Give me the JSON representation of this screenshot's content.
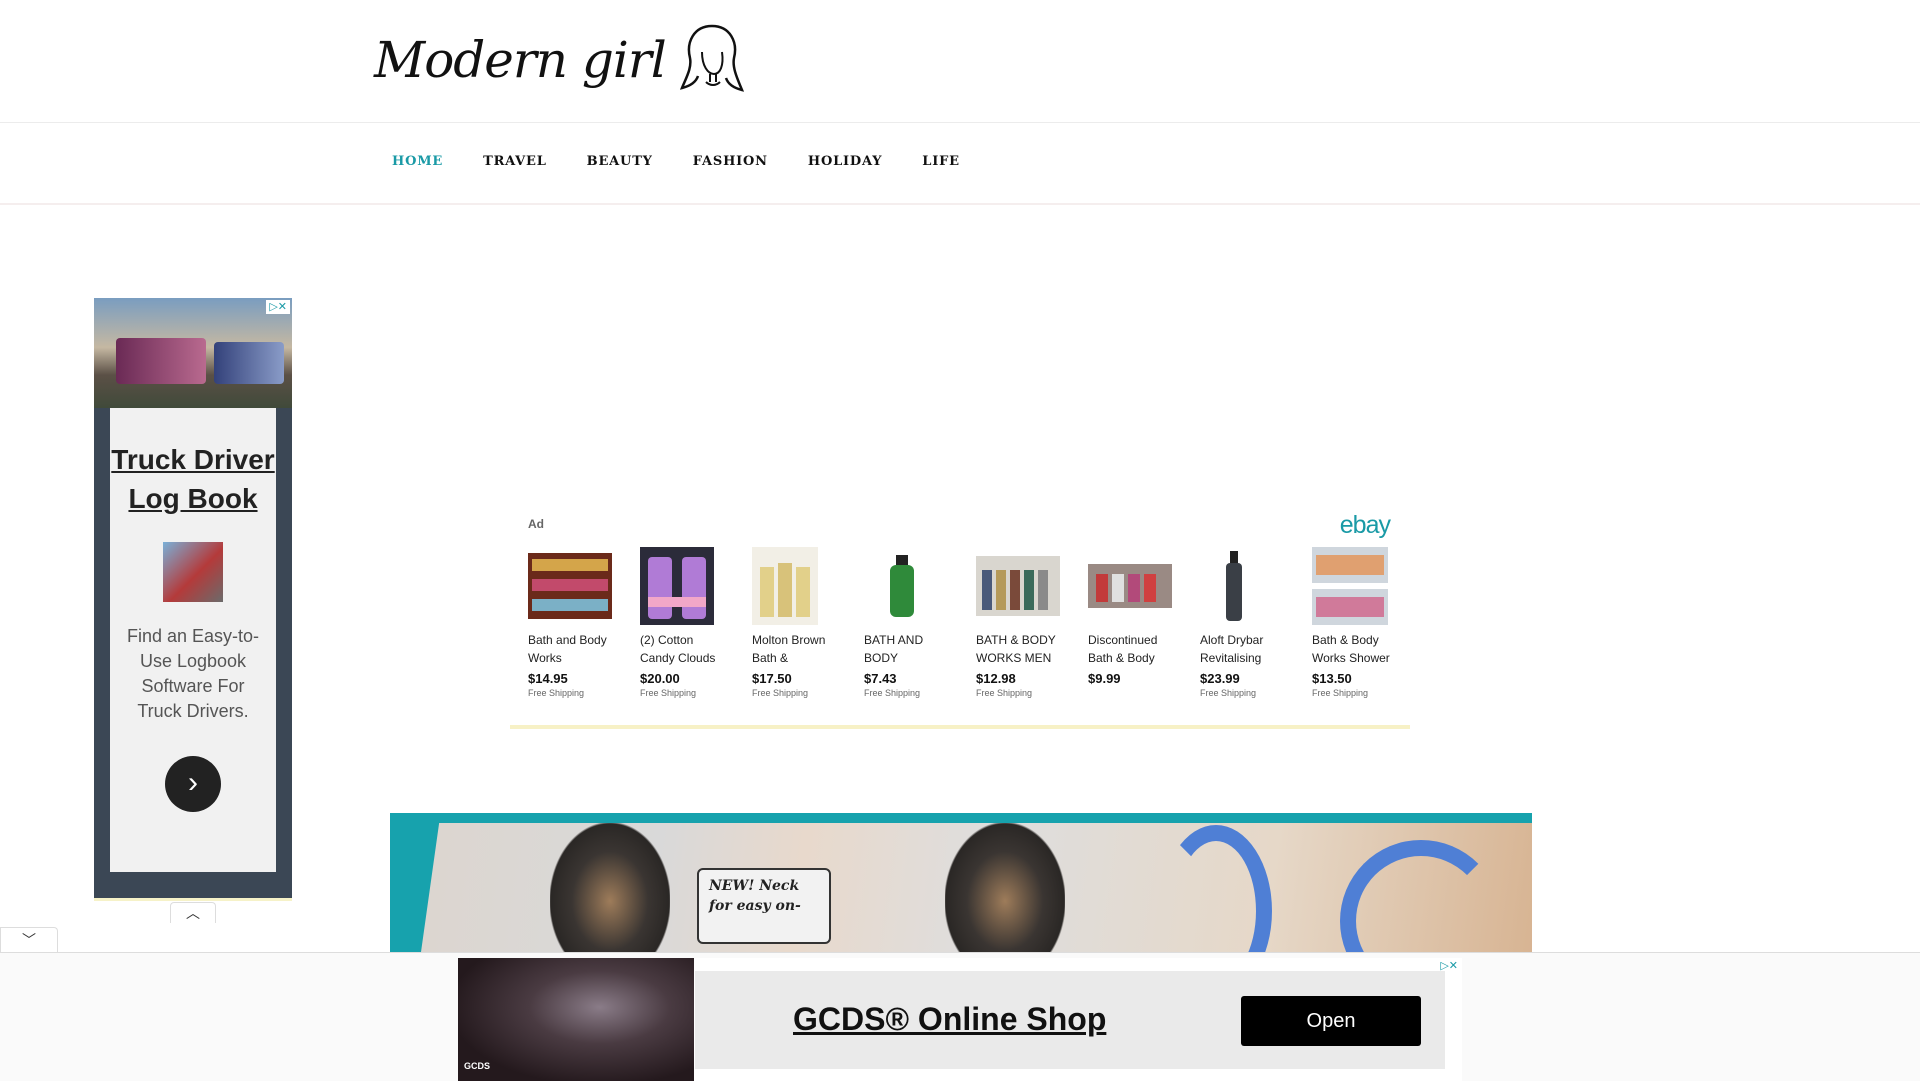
{
  "header": {
    "logo_text": "Modern girl"
  },
  "nav": {
    "items": [
      "HOME",
      "TRAVEL",
      "BEAUTY",
      "FASHION",
      "HOLIDAY",
      "LIFE"
    ]
  },
  "side_ad": {
    "title": "Truck Driver Log Book",
    "description": "Find an Easy-to-Use Logbook Software For Truck Drivers."
  },
  "ebay_ad": {
    "label": "Ad",
    "brand": "ebay",
    "items": [
      {
        "name": "Bath and Body Works",
        "price": "$14.95",
        "shipping": "Free Shipping"
      },
      {
        "name": "(2) Cotton Candy Clouds",
        "price": "$20.00",
        "shipping": "Free Shipping"
      },
      {
        "name": "Molton Brown Bath &",
        "price": "$17.50",
        "shipping": "Free Shipping"
      },
      {
        "name": "BATH AND BODY WORKS",
        "price": "$7.43",
        "shipping": "Free Shipping"
      },
      {
        "name": "BATH & BODY WORKS MEN",
        "price": "$12.98",
        "shipping": "Free Shipping"
      },
      {
        "name": "Discontinued Bath & Body",
        "price": "$9.99",
        "shipping": ""
      },
      {
        "name": "Aloft Drybar Revitalising",
        "price": "$23.99",
        "shipping": "Free Shipping"
      },
      {
        "name": "Bath & Body Works Shower",
        "price": "$13.50",
        "shipping": "Free Shipping"
      }
    ]
  },
  "hero": {
    "tag_line1": "NEW! Neck",
    "tag_line2": "for easy on-"
  },
  "anchor_ad": {
    "title": "GCDS® Online Shop",
    "button": "Open",
    "image_brand": "GCDS"
  },
  "colors": {
    "accent": "#1a9aa6",
    "banner_teal": "#17a2ad"
  }
}
